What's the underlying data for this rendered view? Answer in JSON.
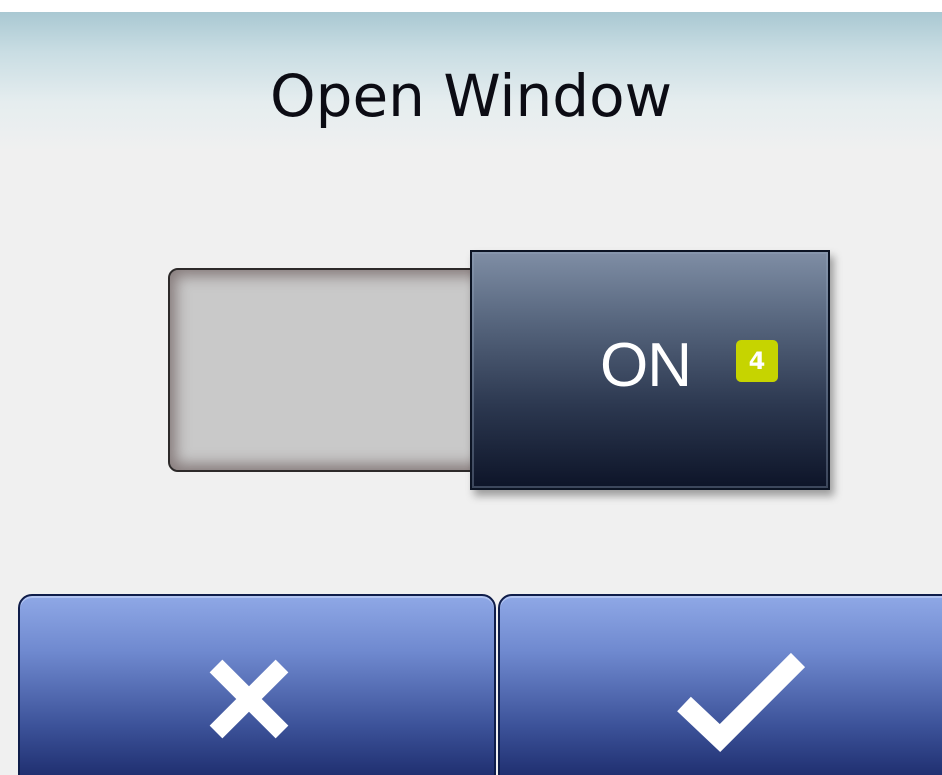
{
  "screen": {
    "title": "Open Window"
  },
  "toggle": {
    "state_label": "ON",
    "badge": "4",
    "state": "on",
    "thumb_color": "#2c3850",
    "badge_color": "#c6d400"
  },
  "actions": {
    "cancel_icon": "close-icon",
    "confirm_icon": "checkmark-icon",
    "button_color": "#4a62ad"
  }
}
